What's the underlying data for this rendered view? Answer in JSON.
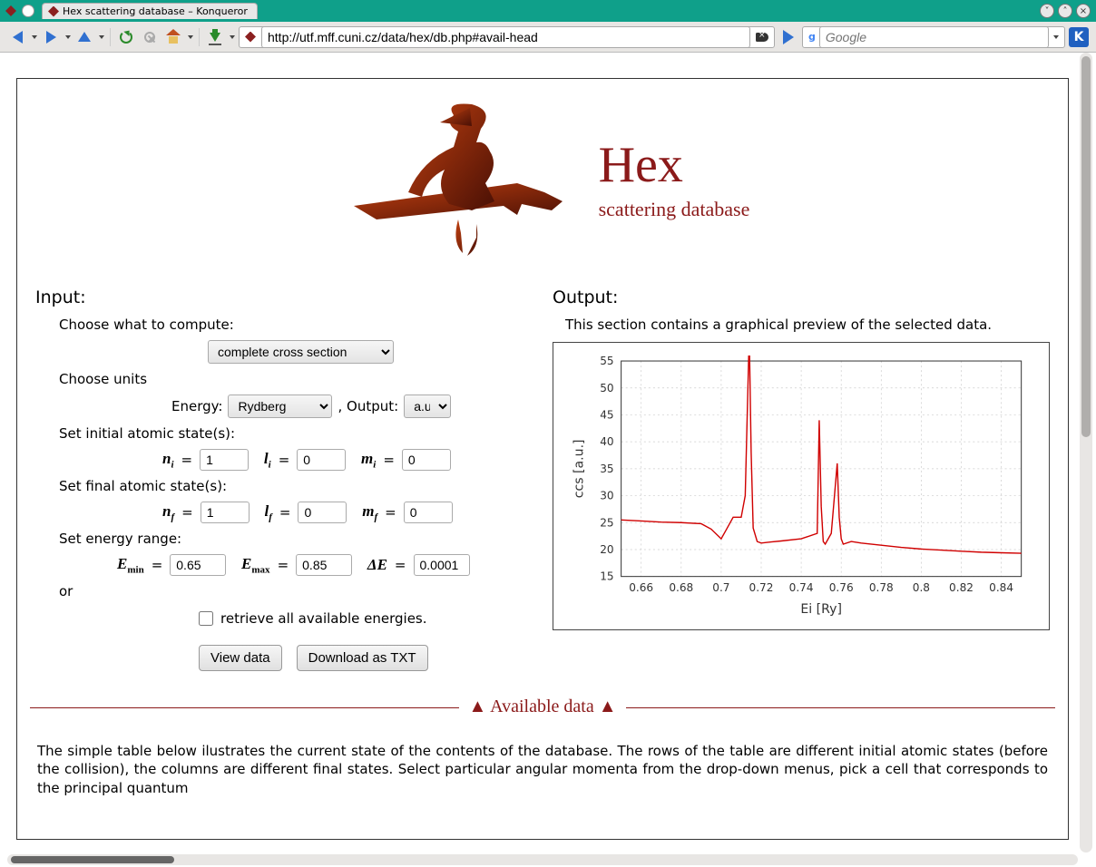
{
  "window": {
    "tab_title": "Hex scattering database – Konqueror",
    "url": "http://utf.mff.cuni.cz/data/hex/db.php#avail-head",
    "search_placeholder": "Google"
  },
  "header": {
    "title": "Hex",
    "subtitle": "scattering database"
  },
  "input": {
    "title": "Input:",
    "compute_label": "Choose what to compute:",
    "compute_value": "complete cross section",
    "units_label": "Choose units",
    "energy_label": "Energy:",
    "energy_value": "Rydberg",
    "output_label": ", Output:",
    "output_value": "a.u.",
    "initial_label": "Set initial atomic state(s):",
    "final_label": "Set final atomic state(s):",
    "ni": "1",
    "li": "0",
    "mi": "0",
    "nf": "1",
    "lf": "0",
    "mf": "0",
    "range_label": "Set energy range:",
    "emin": "0.65",
    "emax": "0.85",
    "de": "0.0001",
    "or_label": "or",
    "retrieve_label": "retrieve all available energies.",
    "view_btn": "View data",
    "download_btn": "Download as TXT"
  },
  "output": {
    "title": "Output:",
    "desc": "This section contains a graphical preview of the selected data."
  },
  "chart_data": {
    "type": "line",
    "xlabel": "Ei [Ry]",
    "ylabel": "ccs [a.u.]",
    "xlim": [
      0.65,
      0.85
    ],
    "ylim": [
      15,
      55
    ],
    "xticks": [
      0.66,
      0.68,
      0.7,
      0.72,
      0.74,
      0.76,
      0.78,
      0.8,
      0.82,
      0.84
    ],
    "yticks": [
      15,
      20,
      25,
      30,
      35,
      40,
      45,
      50,
      55
    ],
    "series": [
      {
        "name": "ccs",
        "color": "#d00000",
        "x": [
          0.65,
          0.66,
          0.67,
          0.68,
          0.69,
          0.695,
          0.7,
          0.703,
          0.706,
          0.71,
          0.712,
          0.714,
          0.715,
          0.716,
          0.718,
          0.72,
          0.725,
          0.73,
          0.74,
          0.748,
          0.749,
          0.75,
          0.751,
          0.752,
          0.755,
          0.758,
          0.759,
          0.76,
          0.761,
          0.765,
          0.77,
          0.78,
          0.79,
          0.8,
          0.81,
          0.82,
          0.83,
          0.84,
          0.85
        ],
        "y": [
          25.5,
          25.3,
          25.1,
          25.0,
          24.8,
          23.8,
          22.0,
          24.0,
          26.0,
          26.0,
          30.0,
          60.0,
          38.0,
          24.0,
          21.5,
          21.2,
          21.4,
          21.6,
          22.0,
          23.0,
          44.0,
          28.0,
          21.5,
          21.0,
          23.0,
          36.0,
          26.0,
          22.0,
          21.0,
          21.5,
          21.2,
          20.8,
          20.4,
          20.1,
          19.9,
          19.7,
          19.5,
          19.4,
          19.3
        ]
      }
    ]
  },
  "avail": {
    "heading": "▲  Available data  ▲",
    "text": "The simple table below ilustrates the current state of the contents of the database. The rows of the table are different initial atomic states (before the collision), the columns are different final states. Select particular angular momenta from the drop-down menus, pick a cell that corresponds to the principal quantum"
  }
}
